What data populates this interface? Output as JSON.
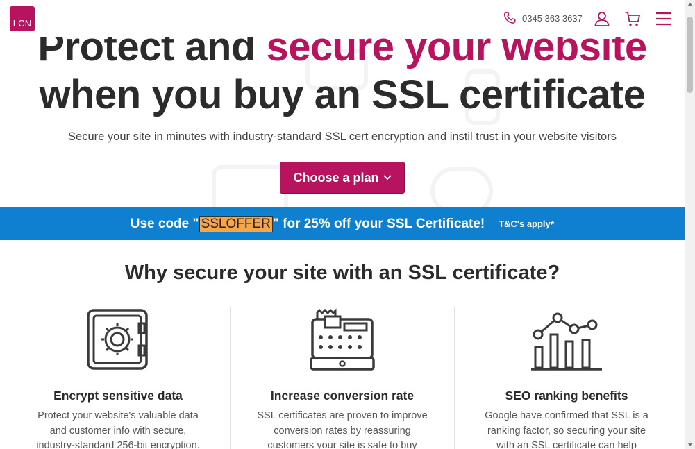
{
  "header": {
    "logo_text": "LCN",
    "phone": "0345 363 3637",
    "icons": [
      "phone-icon",
      "account-icon",
      "cart-icon",
      "menu-icon"
    ]
  },
  "hero": {
    "title_line1_plain": "Protect and ",
    "title_line1_accent": "secure your website",
    "title_line2": "when you buy an SSL certificate",
    "subtitle": "Secure your site in minutes with industry-standard SSL cert encryption and instil trust in your website visitors",
    "cta_label": "Choose a plan"
  },
  "promo": {
    "prefix": "Use code \"",
    "code": "SSLOFFER",
    "suffix": "\" for 25% off your SSL Certificate!",
    "tc_label": "T&C's apply",
    "star": "*"
  },
  "why": {
    "title": "Why secure your site with an SSL certificate?",
    "features": [
      {
        "icon": "safe-icon",
        "title": "Encrypt sensitive data",
        "text": "Protect your website's valuable data and customer info with secure, industry-standard 256-bit encryption."
      },
      {
        "icon": "cash-register-icon",
        "title": "Increase conversion rate",
        "text": "SSL certificates are proven to improve conversion rates by reassuring customers your site is safe to buy from."
      },
      {
        "icon": "seo-chart-icon",
        "title": "SEO ranking benefits",
        "text": "Google have confirmed that SSL is a ranking factor, so securing your site with an SSL certificate can help"
      }
    ]
  },
  "colors": {
    "brand": "#b8135f",
    "promo_bg": "#0f7fcf",
    "code_highlight": "#f7a546"
  }
}
